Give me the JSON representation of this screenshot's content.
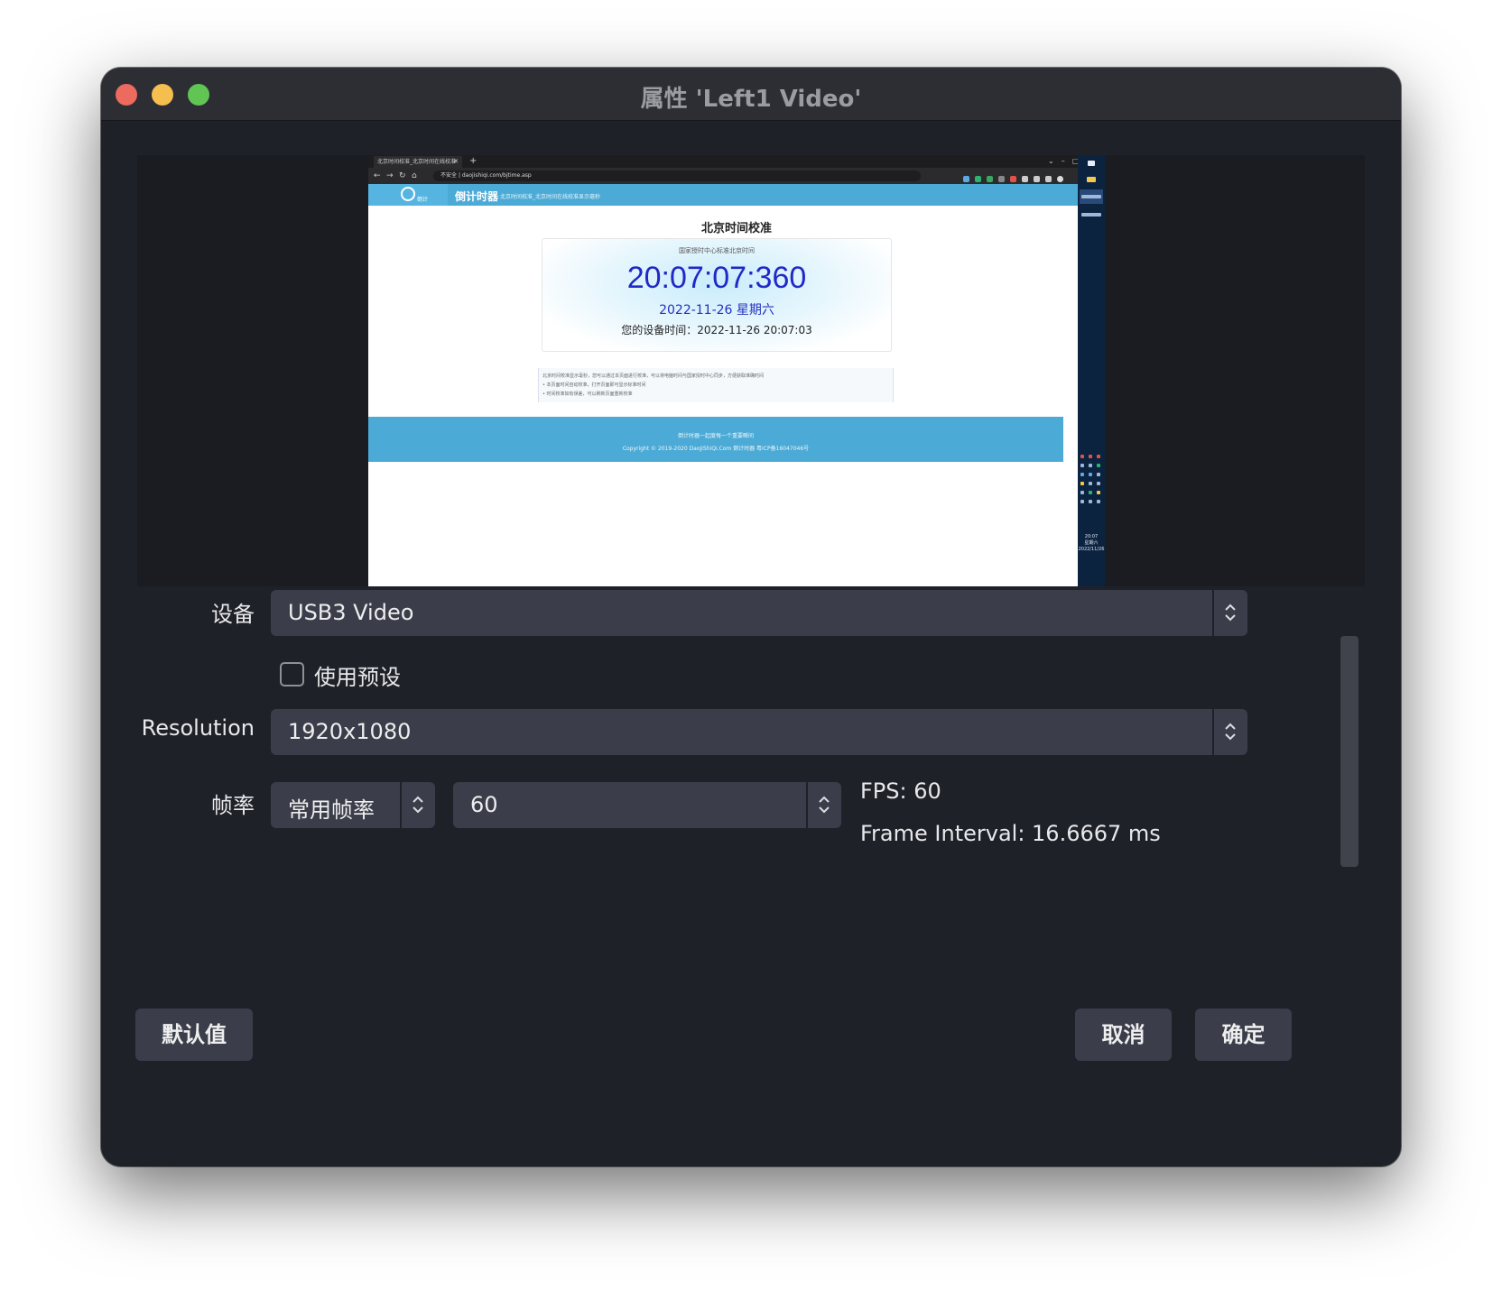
{
  "window": {
    "title": "属性 'Left1 Video'"
  },
  "preview": {
    "browser_tab": "北京时间校准_北京时间在线校准",
    "url": "daojishiqi.com/bjtime.asp",
    "security_label": "不安全",
    "site_logo_text": "倒计",
    "site_name": "倒计时器",
    "site_subtitle": "北京时间校准_北京时间在线校准显示毫秒",
    "page_title": "北京时间校准",
    "clock_caption": "国家授时中心标准北京时间",
    "clock_time": "20:07:07:360",
    "clock_date": "2022-11-26 星期六",
    "device_time": "您的设备时间：2022-11-26 20:07:03",
    "notes": [
      "北京时间校准显示毫秒，您可以通过本页面进行校准，可以将电脑时间与国家授时中心同步，方便获取准确时间",
      "• 本页面时间自动校准，打开页面即可显示标准时间",
      "• 时间校准如有误差，可以刷新页面重新校准"
    ],
    "footer_line1": "倒计时器一起度每一个重要瞬间",
    "footer_line2": "Copyright © 2019-2020 DaoJiShiQi.Com 倒计时器 粤ICP备16047046号",
    "taskbar_time": "20:07",
    "taskbar_weekday": "星期六",
    "taskbar_date": "2022/11/26"
  },
  "form": {
    "device_label": "设备",
    "device_value": "USB3 Video",
    "use_preset_label": "使用预设",
    "use_preset_checked": false,
    "resolution_label": "Resolution",
    "resolution_value": "1920x1080",
    "framerate_label": "帧率",
    "framerate_mode": "常用帧率",
    "framerate_value": "60",
    "fps_text": "FPS: 60",
    "frame_interval_text": "Frame Interval: 16.6667 ms"
  },
  "buttons": {
    "defaults": "默认值",
    "cancel": "取消",
    "ok": "确定"
  },
  "colors": {
    "window_bg": "#1f2129",
    "control_bg": "#3b3e4a",
    "close": "#ed6a5e",
    "minimize": "#f5bf4f",
    "maximize": "#61c554",
    "site_accent": "#4caad6",
    "clock_blue": "#1f29c8"
  }
}
